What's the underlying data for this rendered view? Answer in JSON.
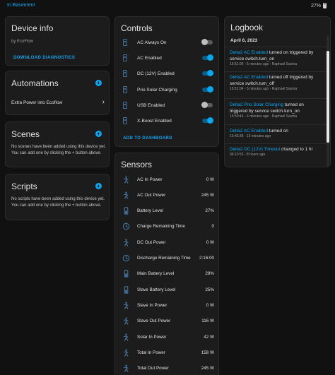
{
  "topbar": {
    "breadcrumb": "In Basement",
    "battery": "27%"
  },
  "device_info": {
    "title": "Device info",
    "by": "by EcoFlow",
    "download_label": "DOWNLOAD DIAGNOSTICS"
  },
  "automations": {
    "title": "Automations",
    "items": [
      {
        "label": "Extra Power into Ecoflow"
      }
    ]
  },
  "scenes": {
    "title": "Scenes",
    "empty_text": "No scenes have been added using this device yet. You can add one by clicking the + button above."
  },
  "scripts": {
    "title": "Scripts",
    "empty_text": "No scripts have been added using this device yet. You can add one by clicking the + button above."
  },
  "controls": {
    "title": "Controls",
    "add_label": "ADD TO DASHBOARD",
    "items": [
      {
        "label": "AC Always On",
        "on": false
      },
      {
        "label": "AC Enabled",
        "on": true
      },
      {
        "label": "DC (12V) Enabled",
        "on": true
      },
      {
        "label": "Prio Solar Charging",
        "on": true
      },
      {
        "label": "USB Enabled",
        "on": false
      },
      {
        "label": "X-Boost Enabled",
        "on": true
      }
    ]
  },
  "sensors": {
    "title": "Sensors",
    "items": [
      {
        "label": "AC In Power",
        "value": "0 W",
        "icon": "power-plug-icon"
      },
      {
        "label": "AC Out Power",
        "value": "245 W",
        "icon": "power-plug-icon"
      },
      {
        "label": "Battery Level",
        "value": "27%",
        "icon": "battery-icon"
      },
      {
        "label": "Charge Remaining Time",
        "value": "0",
        "icon": "clock-icon"
      },
      {
        "label": "DC Out Power",
        "value": "0 W",
        "icon": "power-plug-icon"
      },
      {
        "label": "Discharge Remaining Time",
        "value": "2:16:00",
        "icon": "clock-icon"
      },
      {
        "label": "Main Battery Level",
        "value": "29%",
        "icon": "battery-icon"
      },
      {
        "label": "Slave Battery Level",
        "value": "25%",
        "icon": "battery-icon"
      },
      {
        "label": "Slave In Power",
        "value": "0 W",
        "icon": "power-plug-icon"
      },
      {
        "label": "Slave Out Power",
        "value": "116 W",
        "icon": "power-plug-icon"
      },
      {
        "label": "Solar In Power",
        "value": "42 W",
        "icon": "power-plug-icon"
      },
      {
        "label": "Total In Power",
        "value": "158 W",
        "icon": "power-plug-icon"
      },
      {
        "label": "Total Out Power",
        "value": "245 W",
        "icon": "power-plug-icon"
      }
    ]
  },
  "logbook": {
    "title": "Logbook",
    "date": "April 6, 2023",
    "entries": [
      {
        "entity": "Delta2 AC Enabled",
        "line1": " turned on triggered by",
        "line2": "service switch.turn_on",
        "meta": "15:51:05 - 5 minutes ago - Raphael Savina"
      },
      {
        "entity": "Delta2 AC Enabled",
        "line1": " turned off triggered by",
        "line2": "service switch.turn_off",
        "meta": "15:51:04 - 5 minutes ago - Raphael Savina"
      },
      {
        "entity": "Delta2 Prio Solar Charging",
        "line1": " turned on",
        "line2": "triggered by service switch.turn_on",
        "meta": "15:50:44 - 6 minutes ago - Raphael Savina"
      },
      {
        "entity": "Delta2 AC Enabled",
        "line1": " turned on",
        "line2": "",
        "meta": "15:43:35 - 13 minutes ago"
      },
      {
        "entity": "Delta2 DC (12V) Timeout",
        "line1": " changed to 1 hr",
        "line2": "",
        "meta": "06:10:53 - 8 hours ago"
      }
    ]
  }
}
